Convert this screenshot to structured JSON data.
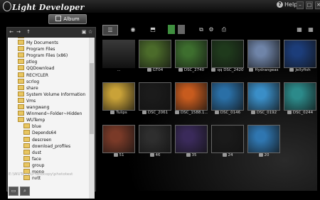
{
  "app": {
    "title": "Light Developer"
  },
  "header": {
    "help": "Help",
    "album": "Album",
    "win": [
      "–",
      "□",
      "✕"
    ]
  },
  "tree": [
    "Document",
    "My Documents",
    "Program Files",
    "Program Files (x86)",
    "ptlog",
    "QQDownload",
    "RECYCLER",
    "scrlog",
    "share",
    "System Volume Information",
    "Vms",
    "wangwang",
    "Winmend~Folder~Hidden",
    "WUTemp",
    "blue",
    "Depends64",
    "descreen",
    "download_profiles",
    "dust",
    "face",
    "group",
    "mono",
    "nvtt"
  ],
  "path": "E:\\WUTemp\\Photocopy\\phototest",
  "thumbs": [
    {
      "label": "..."
    },
    {
      "label": "GT04",
      "b": true
    },
    {
      "label": "DSC_2740",
      "b": true
    },
    {
      "label": "qq DSC_2420",
      "b": true
    },
    {
      "label": "Hydrangeas",
      "b": true
    },
    {
      "label": "Jellyfish",
      "b": true
    },
    {
      "label": "Tulips",
      "b": true
    },
    {
      "label": "DSC_2061",
      "b": true
    },
    {
      "label": "DSC_1588.1...",
      "b": true
    },
    {
      "label": "DSC_0146",
      "b": true
    },
    {
      "label": "DSC_0192",
      "b": true
    },
    {
      "label": "DSC_0244",
      "b": true
    },
    {
      "label": "51",
      "b": true
    },
    {
      "label": "46",
      "b": true
    },
    {
      "label": "35",
      "b": true
    },
    {
      "label": "24",
      "b": true
    },
    {
      "label": "20",
      "b": true
    }
  ],
  "colors": [
    "#2a2a2a",
    "#4b6b2a",
    "#3d6e2e",
    "#1f3a1c",
    "#6f84a8",
    "#1c3d7a",
    "#c9a238",
    "#1b1b1b",
    "#c75b1e",
    "#2a6fa6",
    "#3a8ec7",
    "#2c8a8a",
    "#7a3a28",
    "#2e2e2e",
    "#3a2a5a",
    "#1a1a1a",
    "#2f76b0"
  ]
}
